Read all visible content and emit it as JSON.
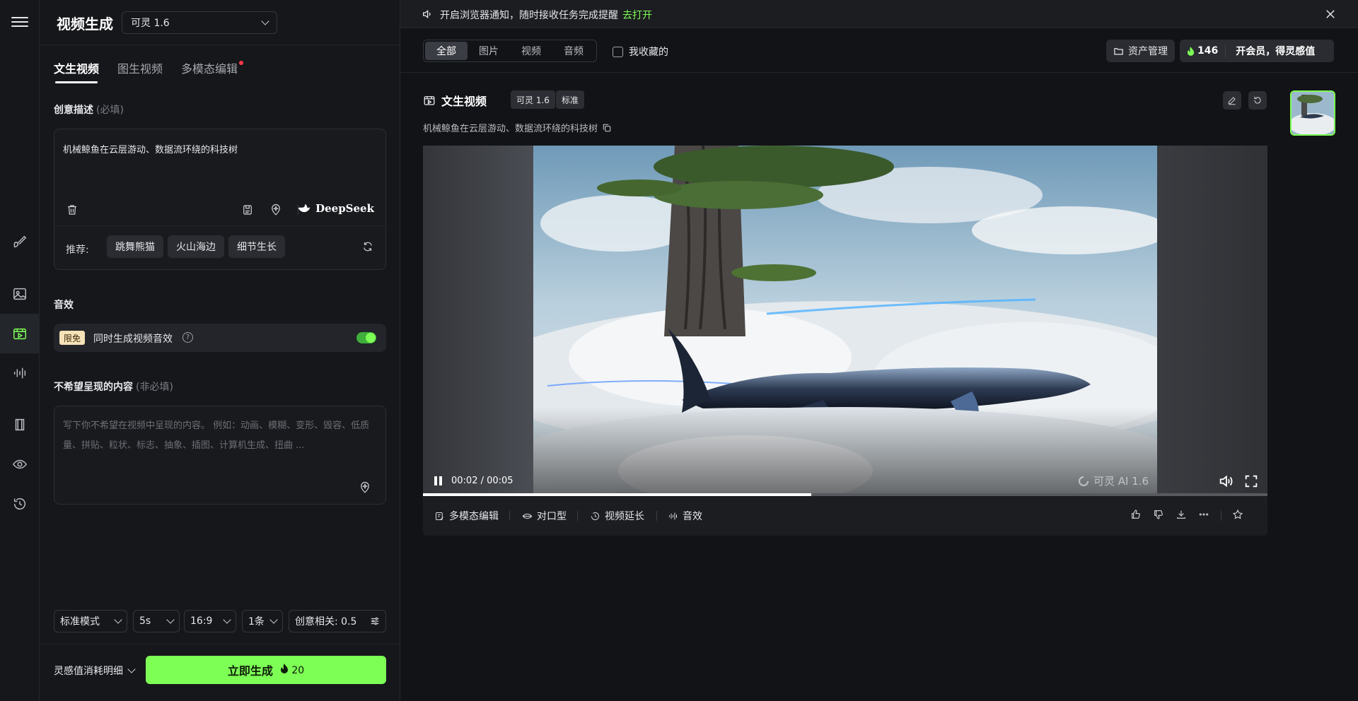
{
  "notice": {
    "text": "开启浏览器通知，随时接收任务完成提醒",
    "link": "去打开"
  },
  "sidebar": {
    "title": "视频生成",
    "model": "可灵 1.6",
    "tabs": [
      "文生视频",
      "图生视频",
      "多模态编辑"
    ],
    "prompt_label": "创意描述",
    "prompt_hint": "(必填)",
    "prompt_text": "机械鲸鱼在云层游动、数据流环绕的科技树",
    "deepseek": "DeepSeek",
    "recommend_label": "推荐:",
    "recommend": [
      "跳舞熊猫",
      "火山海边",
      "细节生长"
    ],
    "audio_label": "音效",
    "audio_badge": "限免",
    "audio_text": "同时生成视频音效",
    "negative_label": "不希望呈现的内容",
    "negative_hint": "(非必填)",
    "negative_placeholder": "写下你不希望在视频中呈现的内容。 例如：动画、模糊、变形、毁容、低质量、拼贴、粒状、标志、抽象、插图、计算机生成、扭曲 ...",
    "options": {
      "mode": "标准模式",
      "duration": "5s",
      "ratio": "16:9",
      "count": "1条",
      "creativity": "创意相关: 0.5"
    },
    "cost_label": "灵感值消耗明细",
    "generate_label": "立即生成",
    "generate_cost": "20"
  },
  "topbar": {
    "filters": [
      "全部",
      "图片",
      "视频",
      "音频"
    ],
    "favorites": "我收藏的",
    "assets": "资产管理",
    "credits": "146",
    "vip": "开会员，得灵感值"
  },
  "result": {
    "title": "文生视频",
    "tags": [
      "可灵 1.6",
      "标准"
    ],
    "prompt": "机械鲸鱼在云层游动、数据流环绕的科技树",
    "time": "00:02 / 00:05",
    "watermark": "可灵 AI 1.6",
    "progress": 0.46,
    "actions": [
      "多模态编辑",
      "对口型",
      "视频延长",
      "音效"
    ]
  },
  "colors": {
    "accent": "#7dff55",
    "background": "#121316",
    "panel": "#16171b"
  }
}
